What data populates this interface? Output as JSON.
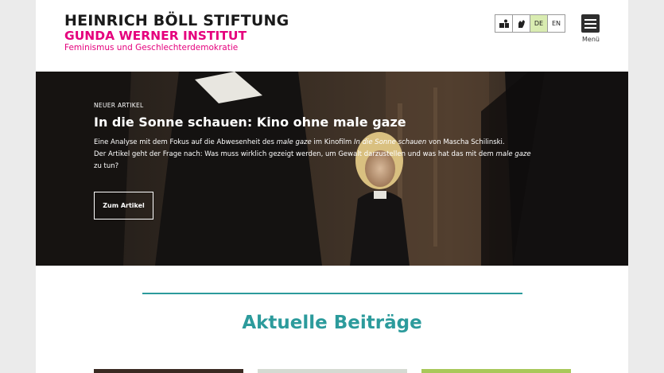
{
  "header": {
    "logo_main": "HEINRICH BÖLL STIFTUNG",
    "logo_sub": "GUNDA WERNER INSTITUT",
    "logo_tagline": "Feminismus und Geschlechterdemokratie",
    "lang_de": "DE",
    "lang_en": "EN",
    "menu_label": "Menü"
  },
  "hero": {
    "eyebrow": "NEUER ARTIKEL",
    "title": "In die Sonne schauen: Kino ohne male gaze",
    "desc_line1_pre": "Eine Analyse mit dem Fokus auf die Abwesenheit des ",
    "desc_line1_em1": "male gaze",
    "desc_line1_mid": " im Kinofilm ",
    "desc_line1_em2": "In die Sonne schauen",
    "desc_line1_post": " von Mascha Schilinski.",
    "desc_line2_pre": "Der Artikel geht der Frage nach: Was muss wirklich gezeigt werden, um Gewalt darzustellen und was hat das mit dem ",
    "desc_line2_em": "male gaze",
    "desc_line2_post": "zu tun?",
    "cta_label": "Zum Artikel"
  },
  "section": {
    "title": "Aktuelle Beiträge"
  },
  "colors": {
    "accent_teal": "#2c9b9c",
    "brand_pink": "#e5007d",
    "lang_active": "#d9ecb1"
  }
}
